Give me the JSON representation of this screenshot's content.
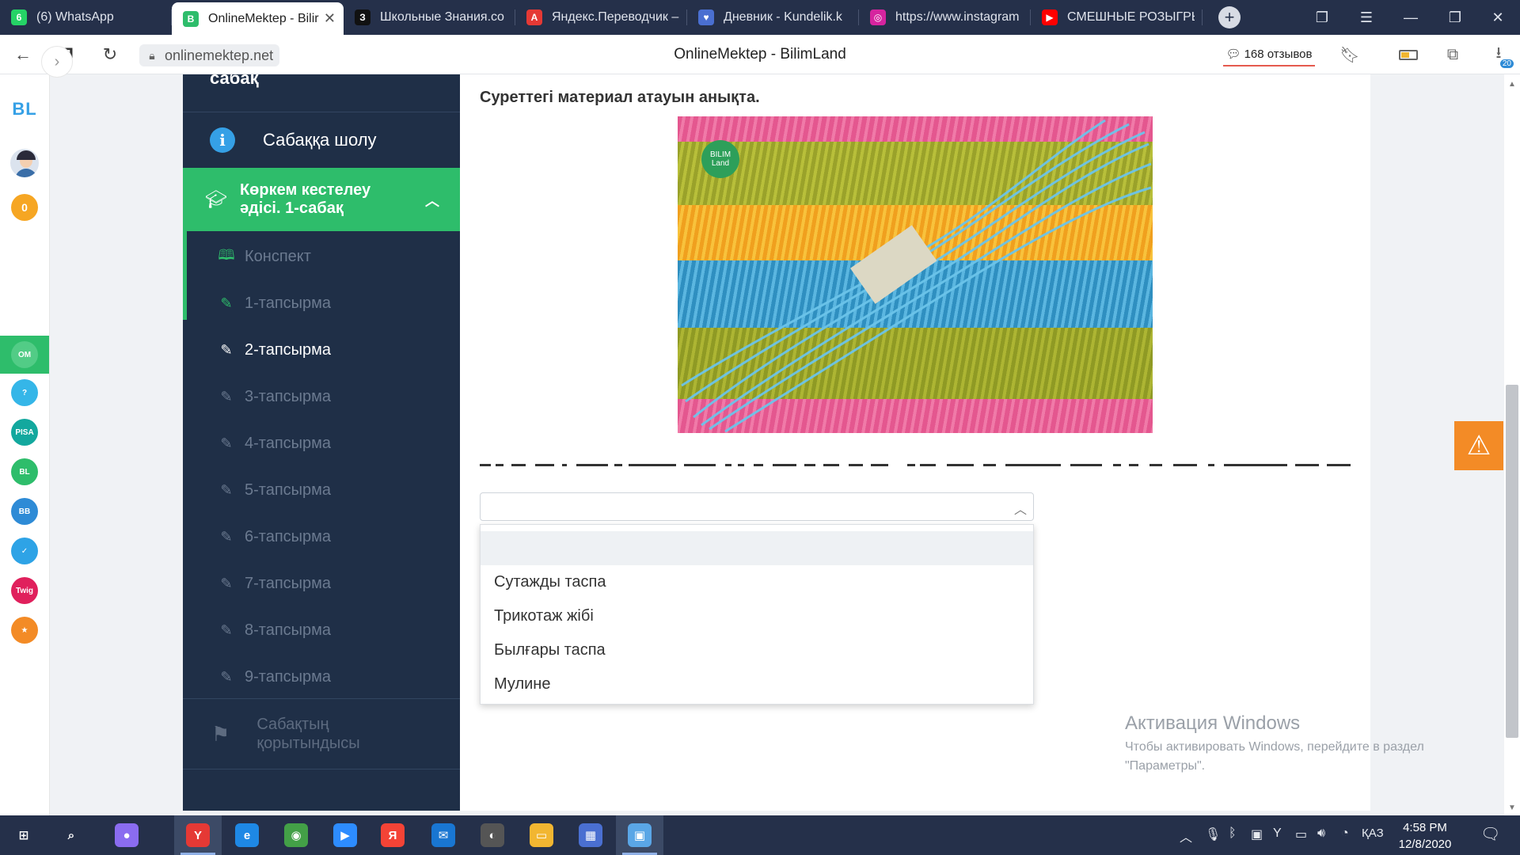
{
  "browser": {
    "tabs": [
      {
        "label": "(6) WhatsApp",
        "icon": "whatsapp-icon",
        "color": "#25d366",
        "glyph": "6",
        "active": false
      },
      {
        "label": "OnlineMektep - Bilir",
        "icon": "bilimland-icon",
        "color": "#2ebd6b",
        "glyph": "B",
        "active": true
      },
      {
        "label": "Школьные Знания.co",
        "icon": "znania-icon",
        "color": "#111111",
        "glyph": "З",
        "active": false
      },
      {
        "label": "Яндекс.Переводчик –",
        "icon": "yandex-translate-icon",
        "color": "#e53935",
        "glyph": "A",
        "active": false
      },
      {
        "label": "Дневник - Kundelik.k",
        "icon": "kundelik-icon",
        "color": "#4a6fd1",
        "glyph": "♥",
        "active": false
      },
      {
        "label": "https://www.instagram",
        "icon": "instagram-icon",
        "color": "#d6249f",
        "glyph": "◎",
        "active": false
      },
      {
        "label": "СМЕШНЫЕ РОЗЫГРЫ",
        "icon": "youtube-icon",
        "color": "#ff0000",
        "glyph": "▶",
        "active": false
      }
    ],
    "close_glyph": "✕",
    "new_tab_glyph": "+",
    "url": "onlinemektep.net",
    "page_title": "OnlineMektep - BilimLand",
    "reviews": "168 отзывов",
    "downloads_badge": "20"
  },
  "left_panel": {
    "logo": "BL",
    "coins": "0",
    "apps": [
      {
        "name": "online-mektep-app",
        "color": "#2ebd6b",
        "text": "OM"
      },
      {
        "name": "help-app",
        "color": "#35b6e8",
        "text": "?"
      },
      {
        "name": "pisa-app",
        "color": "#13a89e",
        "text": "PISA"
      },
      {
        "name": "bilimland-app",
        "color": "#2ebd6b",
        "text": "BL"
      },
      {
        "name": "bilimbook-app",
        "color": "#2e8bd6",
        "text": "BB"
      },
      {
        "name": "test-app",
        "color": "#2ea3e6",
        "text": "✓"
      },
      {
        "name": "twig-app",
        "color": "#e0205c",
        "text": "Twig"
      },
      {
        "name": "bilimland-extra-app",
        "color": "#f38b26",
        "text": "★"
      }
    ]
  },
  "sidebar": {
    "cut_title": "сабақ",
    "overview": "Сабаққа шолу",
    "section_title": "Көркем кестелеу әдісі. 1-сабақ",
    "items": [
      {
        "label": "Конспект",
        "state": "done",
        "icon": "book-icon"
      },
      {
        "label": "1-тапсырма",
        "state": "done",
        "icon": "edit-icon"
      },
      {
        "label": "2-тапсырма",
        "state": "current",
        "icon": "edit-icon"
      },
      {
        "label": "3-тапсырма",
        "state": "todo",
        "icon": "edit-icon"
      },
      {
        "label": "4-тапсырма",
        "state": "todo",
        "icon": "edit-icon"
      },
      {
        "label": "5-тапсырма",
        "state": "todo",
        "icon": "edit-icon"
      },
      {
        "label": "6-тапсырма",
        "state": "todo",
        "icon": "edit-icon"
      },
      {
        "label": "7-тапсырма",
        "state": "todo",
        "icon": "edit-icon"
      },
      {
        "label": "8-тапсырма",
        "state": "todo",
        "icon": "edit-icon"
      },
      {
        "label": "9-тапсырма",
        "state": "todo",
        "icon": "edit-icon"
      }
    ],
    "summary": "Сабақтың қорытындысы"
  },
  "task": {
    "question": "Суреттегі материал атауын анықта.",
    "image_logo": "BILIM Land",
    "selected": "",
    "options": [
      "",
      "Сутажды таспа",
      "Трикотаж жібі",
      "Былғары таспа",
      "Мулине"
    ]
  },
  "watermark": {
    "title": "Активация Windows",
    "line1": "Чтобы активировать Windows, перейдите в раздел",
    "line2": "\"Параметры\"."
  },
  "taskbar": {
    "apps": [
      {
        "name": "start-button",
        "glyph": "⊞",
        "color": "transparent"
      },
      {
        "name": "search-button",
        "glyph": "⌕",
        "color": "transparent"
      },
      {
        "name": "cortana-app",
        "glyph": "●",
        "color": "#8a6cf0"
      },
      {
        "name": "yandex-browser-app",
        "glyph": "Y",
        "color": "#e53935"
      },
      {
        "name": "edge-app",
        "glyph": "e",
        "color": "#1e88e5"
      },
      {
        "name": "chrome-app",
        "glyph": "◉",
        "color": "#43a047"
      },
      {
        "name": "zoom-app",
        "glyph": "▶",
        "color": "#2d8cff"
      },
      {
        "name": "yandex-app",
        "glyph": "Я",
        "color": "#f44336"
      },
      {
        "name": "mail-app",
        "glyph": "✉",
        "color": "#1976d2"
      },
      {
        "name": "media-app",
        "glyph": "◐",
        "color": "#555555"
      },
      {
        "name": "explorer-app",
        "glyph": "▭",
        "color": "#f2b631"
      },
      {
        "name": "store-app",
        "glyph": "▦",
        "color": "#4a6fd1"
      },
      {
        "name": "photos-app",
        "glyph": "▣",
        "color": "#5aa6e6"
      }
    ],
    "language": "ҚАЗ",
    "time": "4:58 PM",
    "date": "12/8/2020"
  },
  "colors": {
    "sidebar_bg": "#1f2f47",
    "accent_green": "#2ebd6b",
    "warning_orange": "#f38b26",
    "tabstrip_bg": "#25304a"
  }
}
